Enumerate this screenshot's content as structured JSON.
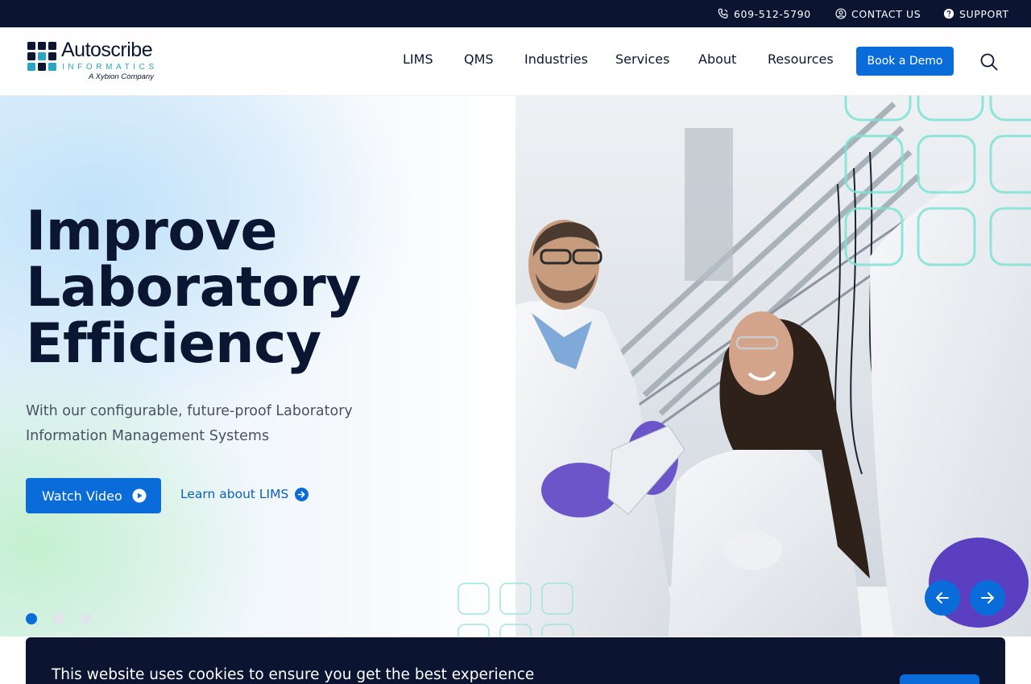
{
  "topbar": {
    "phone": "609-512-5790",
    "contact": "CONTACT US",
    "support": "SUPPORT",
    "phone_icon": "phone-icon",
    "contact_icon": "user-circle-icon",
    "support_icon": "question-circle-icon"
  },
  "header": {
    "logo": {
      "name": "Autoscribe",
      "sub": "INFORMATICS",
      "tagline": "A Xybion Company"
    },
    "nav": [
      "LIMS",
      "QMS",
      "Industries",
      "Services",
      "About",
      "Resources"
    ],
    "demo_button": "Book a Demo",
    "search_icon": "search-icon"
  },
  "hero": {
    "title_lines": [
      "Improve",
      "Laboratory",
      "Efficiency"
    ],
    "subtitle": "With our configurable, future-proof Laboratory Information Management Systems",
    "watch_button": "Watch Video",
    "learn_link": "Learn about LIMS",
    "slide_count": 3,
    "active_slide": 1,
    "prev_icon": "arrow-left-icon",
    "next_icon": "arrow-right-icon"
  },
  "cookie": {
    "text": "This website uses cookies to ensure you get the best experience"
  },
  "colors": {
    "navy": "#0b1430",
    "brand_blue": "#0a6cd8",
    "teal": "#2aa6c4",
    "text_dark": "#0b1633"
  }
}
